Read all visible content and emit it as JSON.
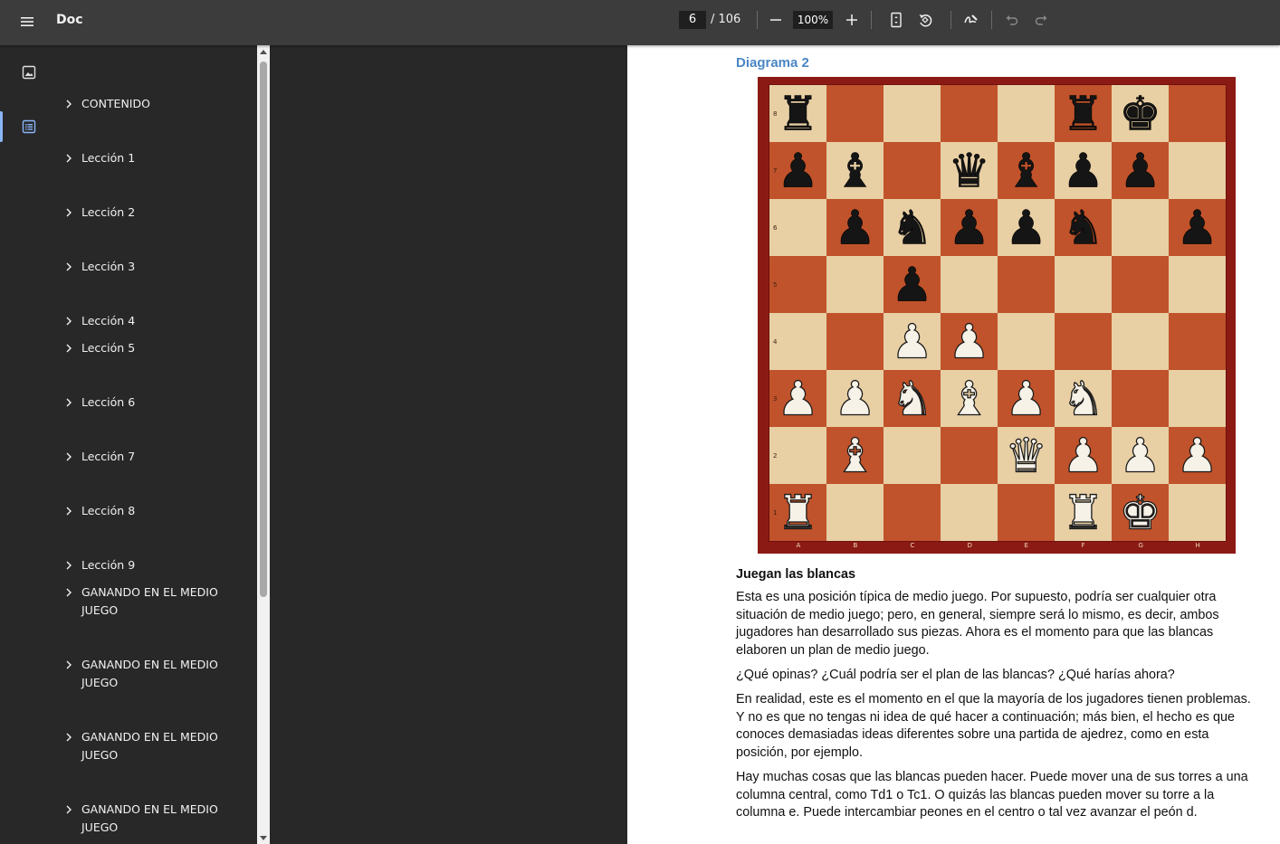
{
  "app": {
    "title": "Doc",
    "page_current": "6",
    "page_total": "/ 106",
    "zoom": "100%"
  },
  "toolbar_icons": [
    "menu-icon",
    "zoom-out-icon",
    "zoom-in-icon",
    "fit-page-icon",
    "rotate-icon",
    "annotate-icon",
    "undo-icon",
    "redo-icon"
  ],
  "rail_icons": [
    "thumbnails-icon",
    "outline-icon"
  ],
  "outline": [
    {
      "label": "CONTENIDO"
    },
    {
      "label": "Lección 1"
    },
    {
      "label": "Lección 2"
    },
    {
      "label": "Lección 3"
    },
    {
      "label": "Lección 4"
    },
    {
      "label": "Lección 5"
    },
    {
      "label": "Lección 6"
    },
    {
      "label": "Lección 7"
    },
    {
      "label": "Lección 8"
    },
    {
      "label": "Lección 9"
    },
    {
      "label": "GANANDO EN EL MEDIO JUEGO"
    },
    {
      "label": "GANANDO EN EL MEDIO JUEGO"
    },
    {
      "label": "GANANDO EN EL MEDIO JUEGO"
    },
    {
      "label": "GANANDO EN EL MEDIO JUEGO"
    }
  ],
  "document": {
    "diagram_title": "Diagrama 2",
    "board": {
      "ranks": [
        "8",
        "7",
        "6",
        "5",
        "4",
        "3",
        "2",
        "1"
      ],
      "files": [
        "A",
        "B",
        "C",
        "D",
        "E",
        "F",
        "G",
        "H"
      ],
      "position": [
        [
          "r",
          "",
          "",
          "",
          "",
          "r",
          "k",
          ""
        ],
        [
          "p",
          "b",
          "",
          "q",
          "b",
          "p",
          "p",
          ""
        ],
        [
          "",
          "p",
          "n",
          "p",
          "p",
          "n",
          "",
          "p"
        ],
        [
          "",
          "",
          "p",
          "",
          "",
          "",
          "",
          ""
        ],
        [
          "",
          "",
          "P",
          "P",
          "",
          "",
          "",
          ""
        ],
        [
          "P",
          "P",
          "N",
          "B",
          "P",
          "N",
          "",
          ""
        ],
        [
          "",
          "B",
          "",
          "",
          "Q",
          "P",
          "P",
          "P"
        ],
        [
          "R",
          "",
          "",
          "",
          "",
          "R",
          "K",
          ""
        ]
      ],
      "light_square": "#e8cfa4",
      "dark_square": "#c0532b",
      "frame": "#8c1a14"
    },
    "heading": "Juegan las blancas",
    "paragraphs": [
      "Esta es una posición típica de medio juego. Por supuesto, podría ser cualquier otra situación de medio juego; pero, en general, siempre será lo mismo, es decir, ambos jugadores han desarrollado sus piezas. Ahora es el momento para que las blancas elaboren un plan de medio juego.",
      "¿Qué opinas? ¿Cuál podría ser el plan de las blancas? ¿Qué harías ahora?",
      "En realidad, este es el momento en el que la mayoría de los jugadores tienen problemas. Y no es que no tengas ni idea de qué hacer a continuación; más bien, el hecho es que conoces demasiadas ideas diferentes sobre una partida de ajedrez, como en esta posición, por ejemplo.",
      "Hay muchas cosas que las blancas pueden hacer. Puede mover una de sus torres a una columna central, como Td1 o Tc1. O quizás las blancas pueden mover su torre a la columna e. Puede intercambiar peones en el centro o tal vez avanzar el peón d."
    ]
  }
}
